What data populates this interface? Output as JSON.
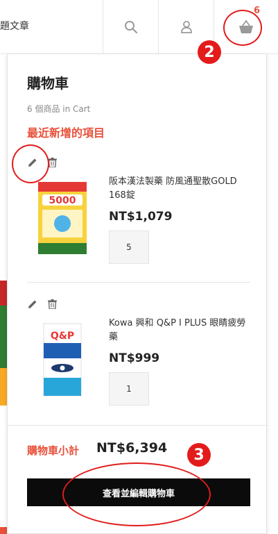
{
  "header": {
    "nav_text": "題文章",
    "cart_count": "6",
    "search_icon": "search-icon",
    "user_icon": "user-icon",
    "cart_icon": "basket-icon"
  },
  "cart": {
    "title": "購物車",
    "count_text": "6 個商品 in Cart",
    "recent_heading": "最近新增的項目",
    "items": [
      {
        "name": "阪本漢法製藥 防風通聖散GOLD 168錠",
        "price": "NT$1,079",
        "qty": "5",
        "thumb_text": "5000"
      },
      {
        "name": "Kowa 興和 Q&P I PLUS 眼睛疲勞藥",
        "price": "NT$999",
        "qty": "1",
        "thumb_text": "Q&P"
      }
    ],
    "subtotal_label": "購物車小計",
    "subtotal_value": "NT$6,394",
    "checkout_label": "查看並編輯購物車"
  },
  "annotations": {
    "badge_2": "2",
    "badge_3": "3"
  },
  "colors": {
    "accent": "#e8503a",
    "annotation": "#e31b1b",
    "button_bg": "#0b0b0b"
  }
}
